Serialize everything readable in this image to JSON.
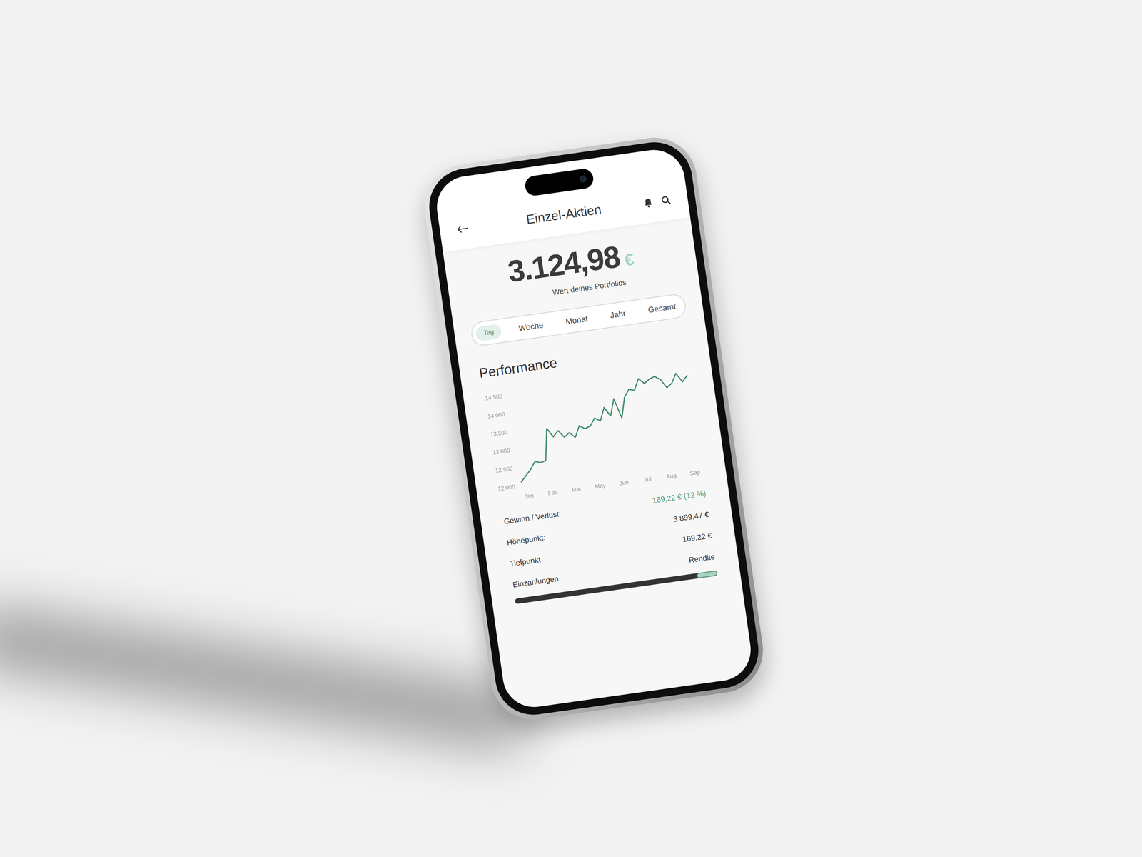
{
  "header": {
    "title": "Einzel-Aktien"
  },
  "portfolio": {
    "value": "3.124,98",
    "currency": "€",
    "caption": "Wert deines Portfolios"
  },
  "tabs": [
    {
      "label": "Tag",
      "selected": true
    },
    {
      "label": "Woche",
      "selected": false
    },
    {
      "label": "Monat",
      "selected": false
    },
    {
      "label": "Jahr",
      "selected": false
    },
    {
      "label": "Gesamt",
      "selected": false
    }
  ],
  "chart": {
    "title": "Performance",
    "y_ticks": [
      "14.500",
      "14.000",
      "13.500",
      "13.000",
      "12.500",
      "12.000"
    ],
    "x_ticks": [
      "Jan",
      "Feb",
      "Mar",
      "May",
      "Jun",
      "Jul",
      "Aug",
      "Sep"
    ],
    "series": [
      {
        "values": [
          12100,
          12250,
          12400,
          12600,
          12550,
          12580,
          13450,
          13200,
          13350,
          13150,
          13250,
          13100,
          13400,
          13300,
          13350,
          13550,
          13450,
          13800,
          13550,
          14000,
          13450,
          14000,
          14200,
          14150,
          14450,
          14300,
          14400,
          14450,
          14350,
          14100,
          14200,
          14450,
          14200,
          14350
        ]
      }
    ]
  },
  "stats": [
    {
      "label": "Gewinn / Verlust:",
      "value": "169,22 € (12 %)",
      "highlight": true
    },
    {
      "label": "Höhepunkt:",
      "value": "3.899,47 €",
      "highlight": false
    },
    {
      "label": "Tiefpunkt",
      "value": "169,22 €",
      "highlight": false
    },
    {
      "label": "Einzahlungen",
      "value": "Rendite",
      "highlight": false
    }
  ],
  "progress": {
    "level": 0.1
  }
}
